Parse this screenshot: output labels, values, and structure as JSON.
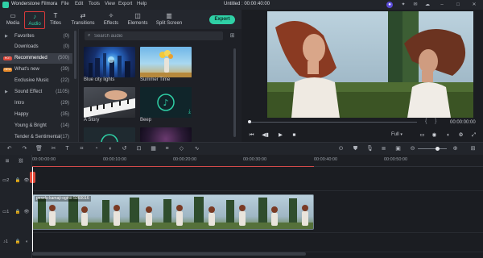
{
  "app": {
    "name": "Wonderstone Filmora",
    "document_title": "Untitled : 00:00:40:00",
    "menu": [
      "File",
      "Edit",
      "Tools",
      "View",
      "Export",
      "Help"
    ]
  },
  "toolbar": {
    "tools": [
      {
        "label": "Media",
        "icon": "folder-icon"
      },
      {
        "label": "Audio",
        "icon": "music-note-icon",
        "selected": true
      },
      {
        "label": "Titles",
        "icon": "text-t-icon"
      },
      {
        "label": "Transitions",
        "icon": "transition-icon"
      },
      {
        "label": "Effects",
        "icon": "effects-icon"
      },
      {
        "label": "Elements",
        "icon": "elements-icon"
      },
      {
        "label": "Split Screen",
        "icon": "split-screen-icon"
      }
    ],
    "export_label": "Export"
  },
  "sidebar": {
    "items": [
      {
        "label": "Favorites",
        "count": "(0)",
        "expandable": true
      },
      {
        "label": "Downloads",
        "count": "(0)"
      },
      {
        "label": "Recommended",
        "count": "(500)",
        "badge": "HOT",
        "selected": true
      },
      {
        "label": "What's new",
        "count": "(39)",
        "badge": "NEW"
      },
      {
        "label": "Exclusive Music",
        "count": "(22)"
      },
      {
        "label": "Sound Effect",
        "count": "(1105)",
        "expandable": true
      },
      {
        "label": "Intro",
        "count": "(29)"
      },
      {
        "label": "Happy",
        "count": "(35)"
      },
      {
        "label": "Young & Bright",
        "count": "(14)"
      },
      {
        "label": "Tender & Sentimental",
        "count": "(17)"
      }
    ]
  },
  "browser": {
    "search_placeholder": "Search audio",
    "cards": [
      {
        "name": "Blue city lights"
      },
      {
        "name": "Summer Time"
      },
      {
        "name": "A Story"
      },
      {
        "name": "Beep"
      },
      {
        "name": ""
      },
      {
        "name": ""
      }
    ]
  },
  "preview": {
    "time": "00:00:00:00",
    "quality": "Full",
    "brackets": [
      "{",
      "}"
    ]
  },
  "timeline": {
    "ruler_labels": [
      "00:00:00:00",
      "00:00:10:00",
      "00:00:20:00",
      "00:00:30:00",
      "00:00:40:00",
      "00:00:50:00"
    ],
    "clip_title": "pexels-kamaji-ogino-5060016"
  },
  "colors": {
    "accent": "#2fd0a6",
    "highlight_box": "#d83a3a",
    "playhead": "#e24b3b"
  }
}
